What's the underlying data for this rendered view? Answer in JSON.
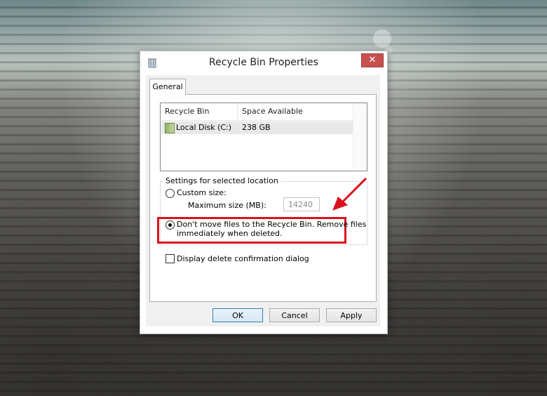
{
  "window": {
    "title": "Recycle Bin Properties",
    "close_glyph": "✕"
  },
  "tabs": [
    {
      "label": "General"
    }
  ],
  "listview": {
    "columns": [
      "Recycle Bin Location",
      "Space Available"
    ],
    "rows": [
      {
        "icon": "drive-icon",
        "location": "Local Disk (C:)",
        "space": "238 GB"
      }
    ]
  },
  "settings": {
    "legend": "Settings for selected location",
    "custom_size_label": "Custom size:",
    "max_size_label": "Maximum size (MB):",
    "max_size_value": "14240",
    "dont_move_label_line1": "Don't move files to the Recycle Bin. Remove files",
    "dont_move_label_line2": "immediately when deleted.",
    "selected_option": "dont_move"
  },
  "confirm_dialog_label": "Display delete confirmation dialog",
  "confirm_dialog_checked": false,
  "buttons": {
    "ok": "OK",
    "cancel": "Cancel",
    "apply": "Apply"
  },
  "colors": {
    "highlight": "#d9121e",
    "close_button": "#c75050"
  }
}
